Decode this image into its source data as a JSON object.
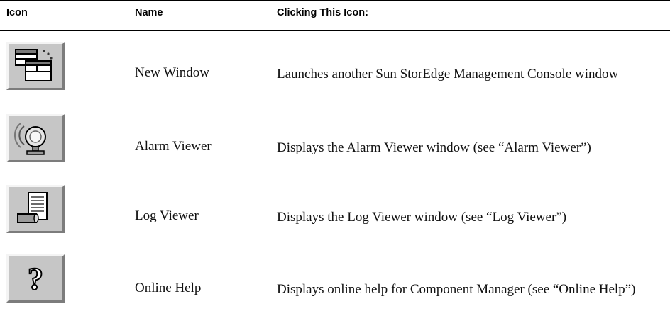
{
  "table": {
    "headers": {
      "icon": "Icon",
      "name": "Name",
      "clicking": "Clicking This Icon:"
    },
    "rows": [
      {
        "icon": "new-window-icon",
        "name": "New Window",
        "description": "Launches another Sun StorEdge Management Console window"
      },
      {
        "icon": "alarm-viewer-icon",
        "name": "Alarm Viewer",
        "description": "Displays the Alarm Viewer window (see “Alarm Viewer”)"
      },
      {
        "icon": "log-viewer-icon",
        "name": "Log Viewer",
        "description": "Displays the Log Viewer window (see “Log Viewer”)"
      },
      {
        "icon": "online-help-icon",
        "name": "Online Help",
        "description": "Displays online help for Component Manager (see “Online Help”)"
      }
    ]
  }
}
